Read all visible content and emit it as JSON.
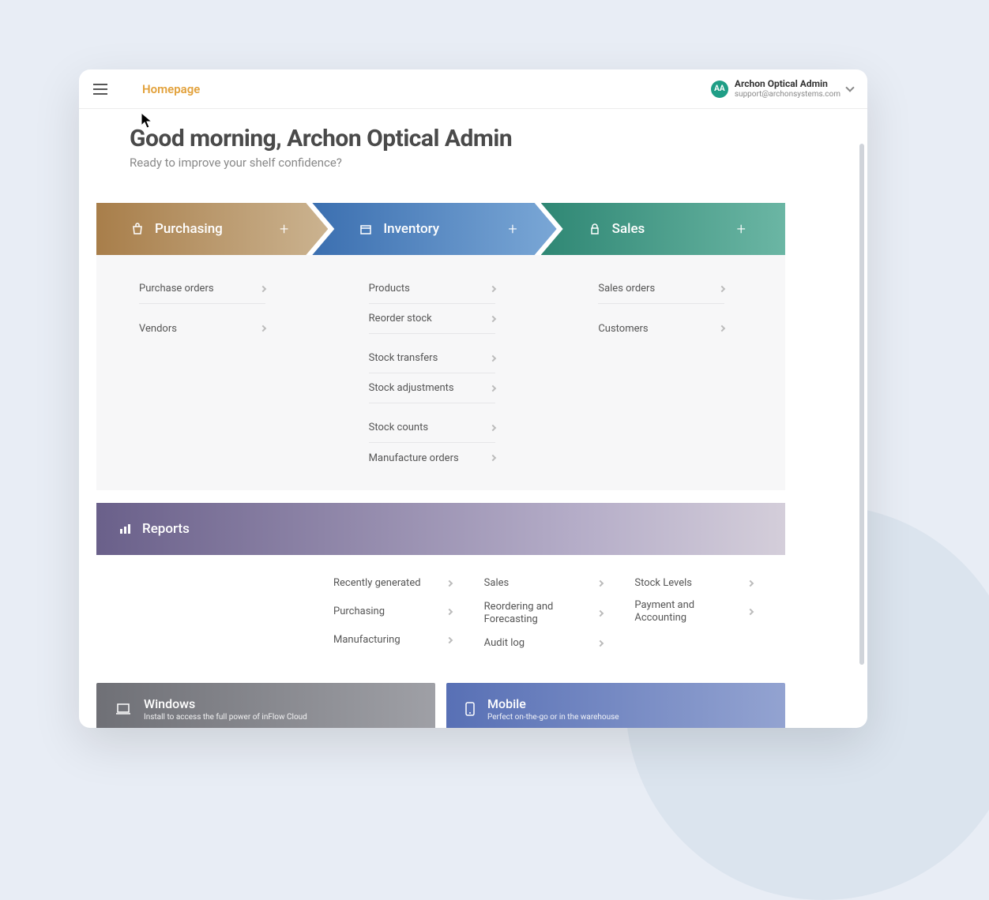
{
  "header": {
    "breadcrumb": "Homepage",
    "user_name": "Archon Optical Admin",
    "user_email": "support@archonsystems.com",
    "avatar_initials": "AA"
  },
  "hero": {
    "greeting": "Good morning, Archon Optical Admin",
    "subtitle": "Ready to improve your shelf confidence?"
  },
  "pipeline": {
    "purchasing": "Purchasing",
    "inventory": "Inventory",
    "sales": "Sales"
  },
  "links": {
    "purchasing": [
      "Purchase orders",
      "Vendors"
    ],
    "inventory": [
      "Products",
      "Reorder stock",
      "Stock transfers",
      "Stock adjustments",
      "Stock counts",
      "Manufacture orders"
    ],
    "sales": [
      "Sales orders",
      "Customers"
    ]
  },
  "reports": {
    "header": "Reports",
    "col1": [
      "Recently generated",
      "Purchasing",
      "Manufacturing"
    ],
    "col2": [
      "Sales",
      "Reordering and Forecasting",
      "Audit log"
    ],
    "col3": [
      "Stock Levels",
      "Payment and Accounting"
    ]
  },
  "platforms": {
    "windows_title": "Windows",
    "windows_sub": "Install to access the full power of inFlow Cloud",
    "mobile_title": "Mobile",
    "mobile_sub": "Perfect on-the-go or in the warehouse"
  }
}
